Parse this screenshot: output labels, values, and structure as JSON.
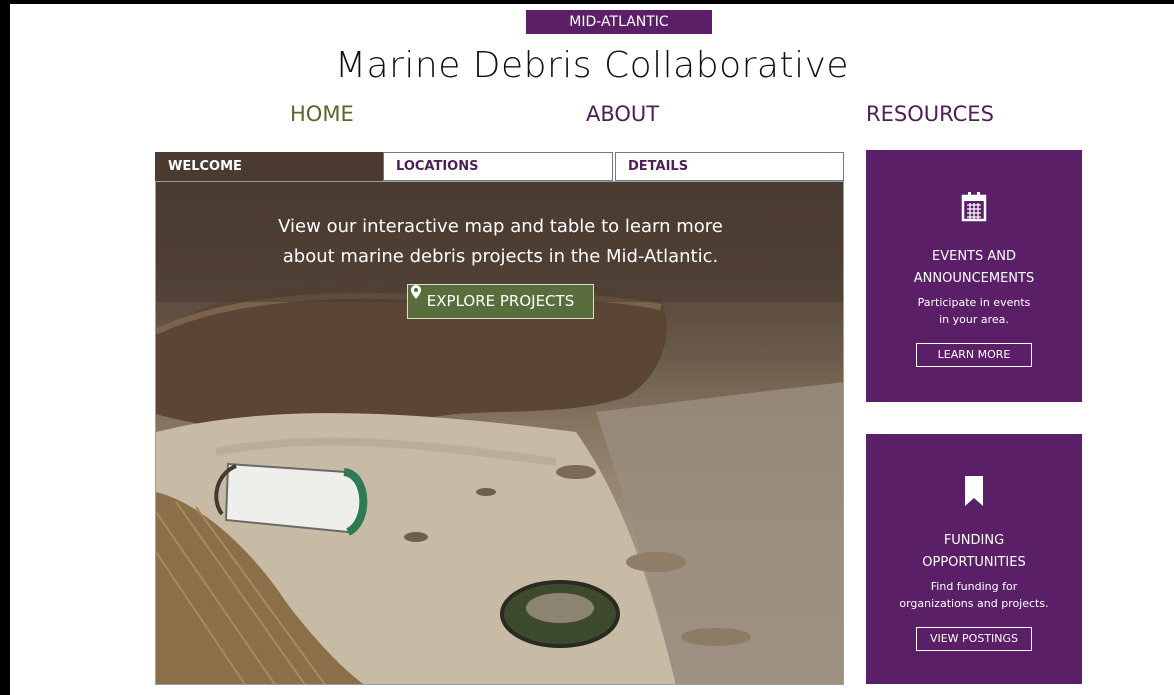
{
  "header": {
    "region_badge": "MID-ATLANTIC",
    "title": "Marine Debris Collaborative"
  },
  "nav": {
    "home": "HOME",
    "about": "ABOUT",
    "resources": "RESOURCES"
  },
  "tabs": [
    {
      "label": "WELCOME",
      "active": true
    },
    {
      "label": "LOCATIONS",
      "active": false
    },
    {
      "label": "DETAILS",
      "active": false
    }
  ],
  "hero": {
    "line1": "View our interactive map and table to learn more",
    "line2": "about marine debris projects in the Mid-Atlantic.",
    "button_label": "EXPLORE PROJECTS",
    "button_icon": "map-pin-icon"
  },
  "cards": {
    "events": {
      "icon": "calendar-icon",
      "title_line1": "EVENTS AND",
      "title_line2": "ANNOUNCEMENTS",
      "desc_line1": "Participate in events",
      "desc_line2": "in your area.",
      "button_label": "LEARN MORE"
    },
    "funding": {
      "icon": "bookmark-icon",
      "title_line1": "FUNDING",
      "title_line2": "OPPORTUNITIES",
      "desc_line1": "Find funding for",
      "desc_line2": "organizations and projects.",
      "button_label": "VIEW POSTINGS"
    }
  },
  "colors": {
    "brand_purple": "#5a1f66",
    "nav_home_green": "#56692b",
    "button_green": "#5a6e3d"
  }
}
